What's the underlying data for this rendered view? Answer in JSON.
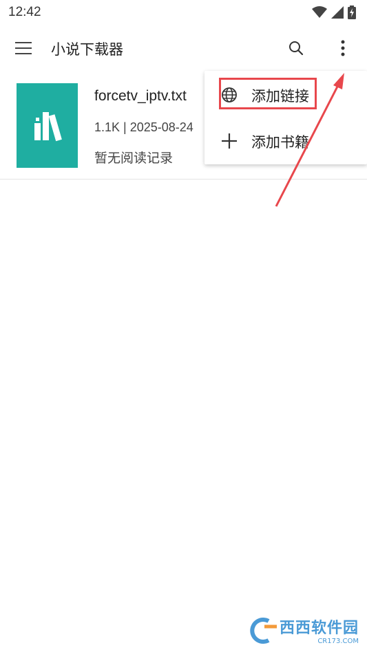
{
  "status_bar": {
    "time": "12:42"
  },
  "app_bar": {
    "title": "小说下载器"
  },
  "book": {
    "title": "forcetv_iptv.txt",
    "meta": "1.1K | 2025-08-24",
    "progress": "暂无阅读记录"
  },
  "menu": {
    "items": [
      {
        "label": "添加链接",
        "icon": "globe-icon"
      },
      {
        "label": "添加书籍",
        "icon": "plus-icon"
      }
    ]
  },
  "colors": {
    "cover": "#1faea1",
    "highlight": "#e8474c"
  },
  "watermark": {
    "text": "西西软件园",
    "sub": "CR173.COM"
  }
}
